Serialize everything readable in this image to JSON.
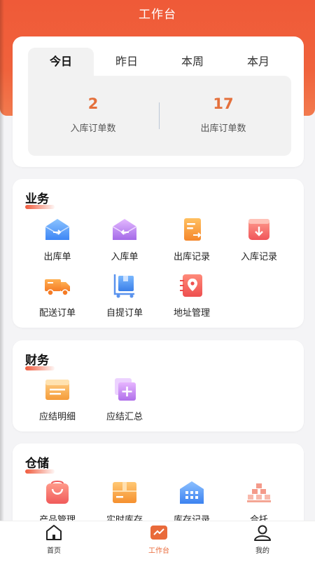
{
  "app_title": "工作台",
  "stats": {
    "tabs": [
      "今日",
      "昨日",
      "本周",
      "本月"
    ],
    "active_tab": "今日",
    "inbound_count": "2",
    "inbound_label": "入库订单数",
    "outbound_count": "17",
    "outbound_label": "出库订单数"
  },
  "business": {
    "title": "业务",
    "items": [
      {
        "label": "出库单",
        "icon": "outbound-order-icon"
      },
      {
        "label": "入库单",
        "icon": "inbound-order-icon"
      },
      {
        "label": "出库记录",
        "icon": "outbound-record-icon"
      },
      {
        "label": "入库记录",
        "icon": "inbound-record-icon"
      },
      {
        "label": "配送订单",
        "icon": "delivery-truck-icon"
      },
      {
        "label": "自提订单",
        "icon": "self-pickup-cart-icon"
      },
      {
        "label": "地址管理",
        "icon": "location-pin-icon"
      }
    ]
  },
  "finance": {
    "title": "财务",
    "items": [
      {
        "label": "应结明细",
        "icon": "settlement-detail-icon"
      },
      {
        "label": "应结汇总",
        "icon": "settlement-summary-icon"
      }
    ]
  },
  "storage": {
    "title": "仓储",
    "items": [
      {
        "label": "产品管理",
        "icon": "product-bag-icon"
      },
      {
        "label": "实时库存",
        "icon": "realtime-stock-box-icon"
      },
      {
        "label": "库存记录",
        "icon": "stock-record-building-icon"
      },
      {
        "label": "合托",
        "icon": "pallet-merge-icon"
      }
    ]
  },
  "tabbar": {
    "items": [
      {
        "label": "首页",
        "icon": "home-icon"
      },
      {
        "label": "工作台",
        "icon": "workbench-icon"
      },
      {
        "label": "我的",
        "icon": "profile-icon"
      }
    ],
    "active": "工作台"
  },
  "colors": {
    "brand": "#ef5a38",
    "stat_number": "#e4703c",
    "tab_active": "#e96a3a"
  }
}
